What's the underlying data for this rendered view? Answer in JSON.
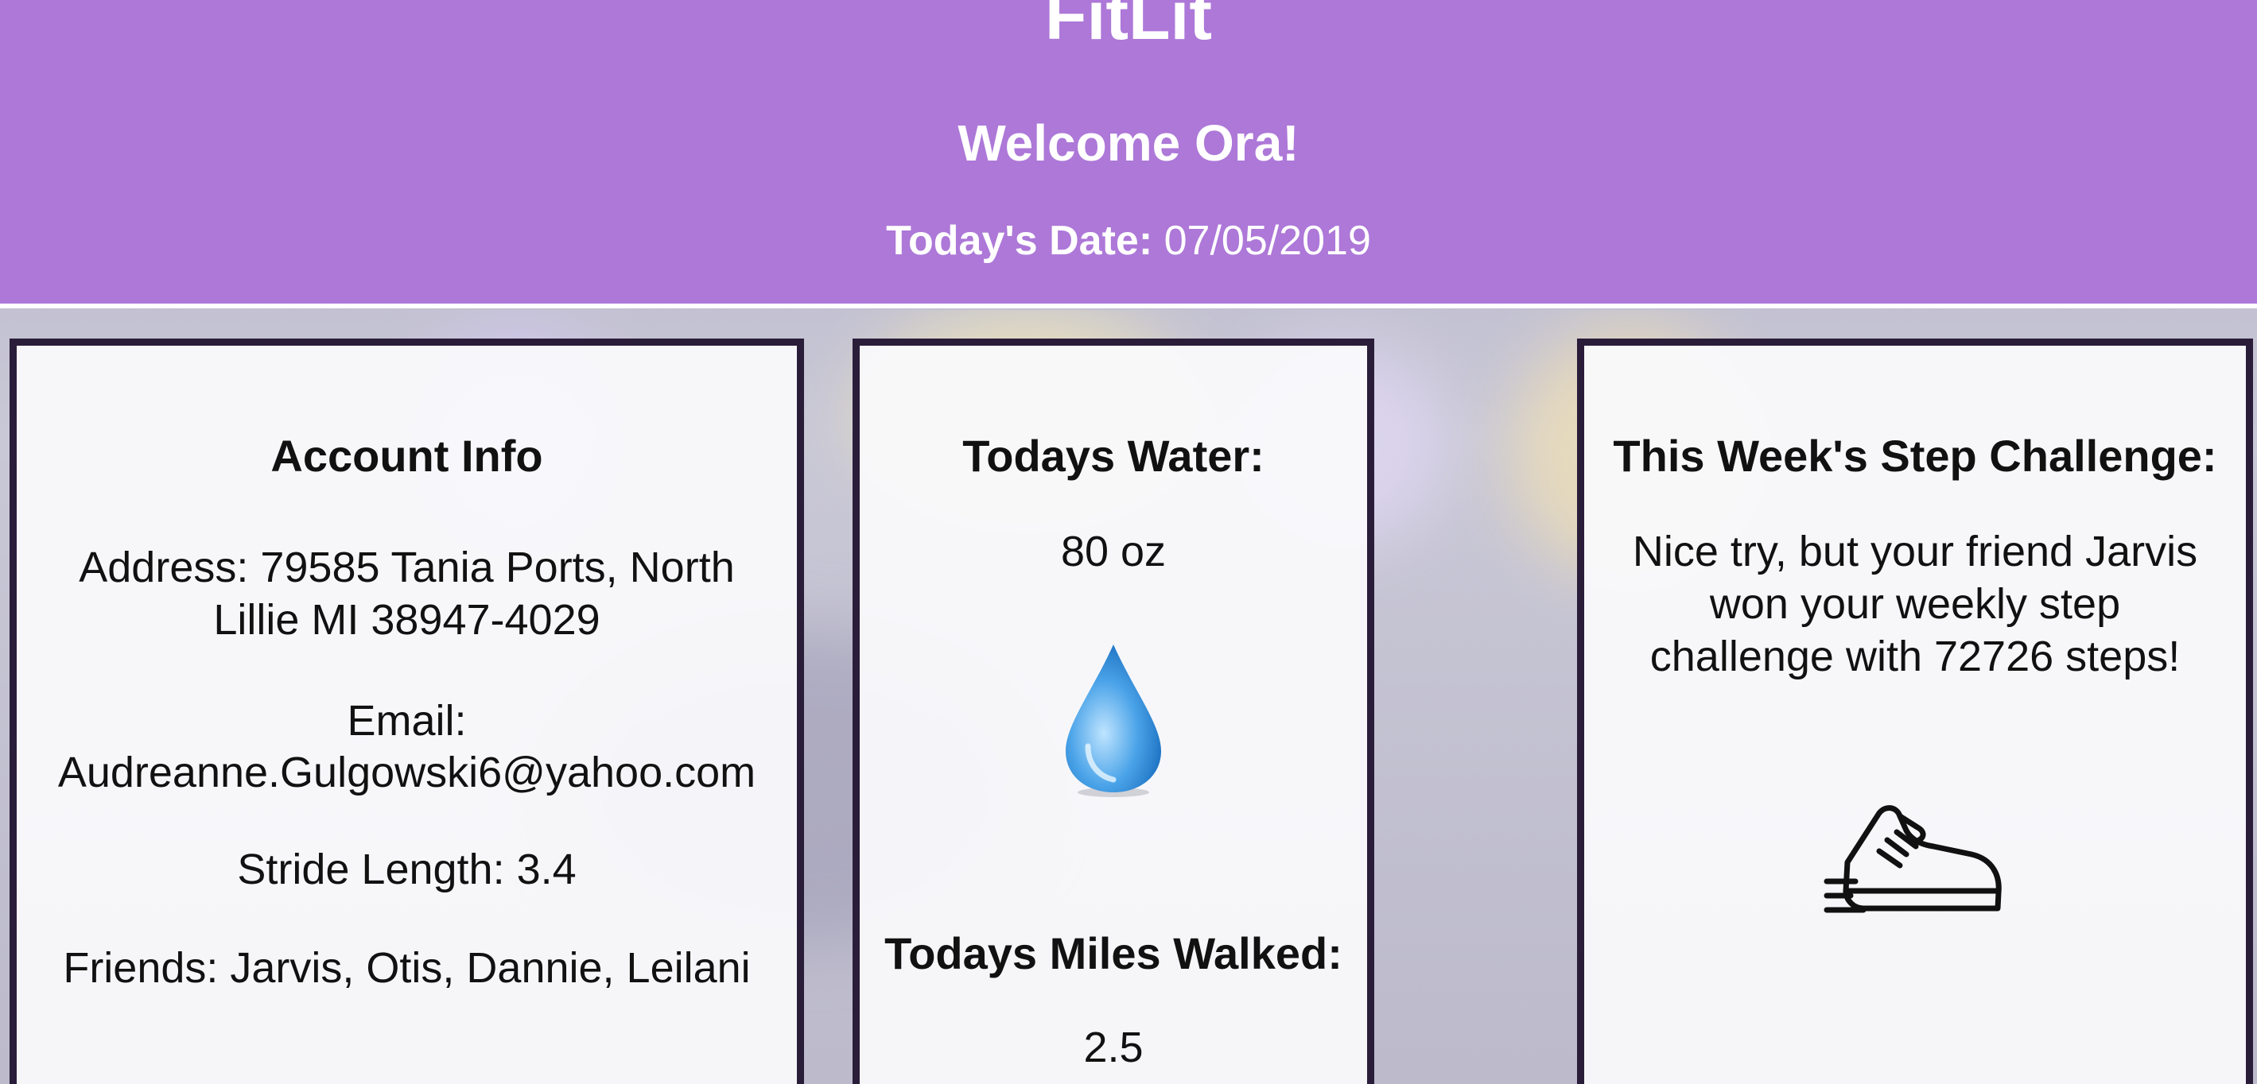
{
  "header": {
    "app_title": "FitLit",
    "welcome_label": "Welcome",
    "user_name": "Ora!",
    "date_label": "Today's Date:",
    "date_value": "07/05/2019"
  },
  "account": {
    "title": "Account Info",
    "address": "Address: 79585 Tania Ports, North Lillie MI 38947-4029",
    "email_label": "Email:",
    "email_value": "Audreanne.Gulgowski6@yahoo.com",
    "stride": "Stride Length: 3.4",
    "friends": "Friends: Jarvis, Otis, Dannie, Leilani"
  },
  "water": {
    "title": "Todays Water:",
    "value": "80 oz",
    "icon": "water-drop-icon",
    "miles_title": "Todays Miles Walked:",
    "miles_value": "2.5"
  },
  "challenge": {
    "title": "This Week's Step Challenge:",
    "message": "Nice try, but your friend Jarvis won your weekly step challenge with 72726 steps!",
    "icon": "sneaker-icon"
  },
  "colors": {
    "header_bg": "#ad78d8",
    "card_border": "#2a1d3a",
    "header_text": "#ffffff"
  }
}
